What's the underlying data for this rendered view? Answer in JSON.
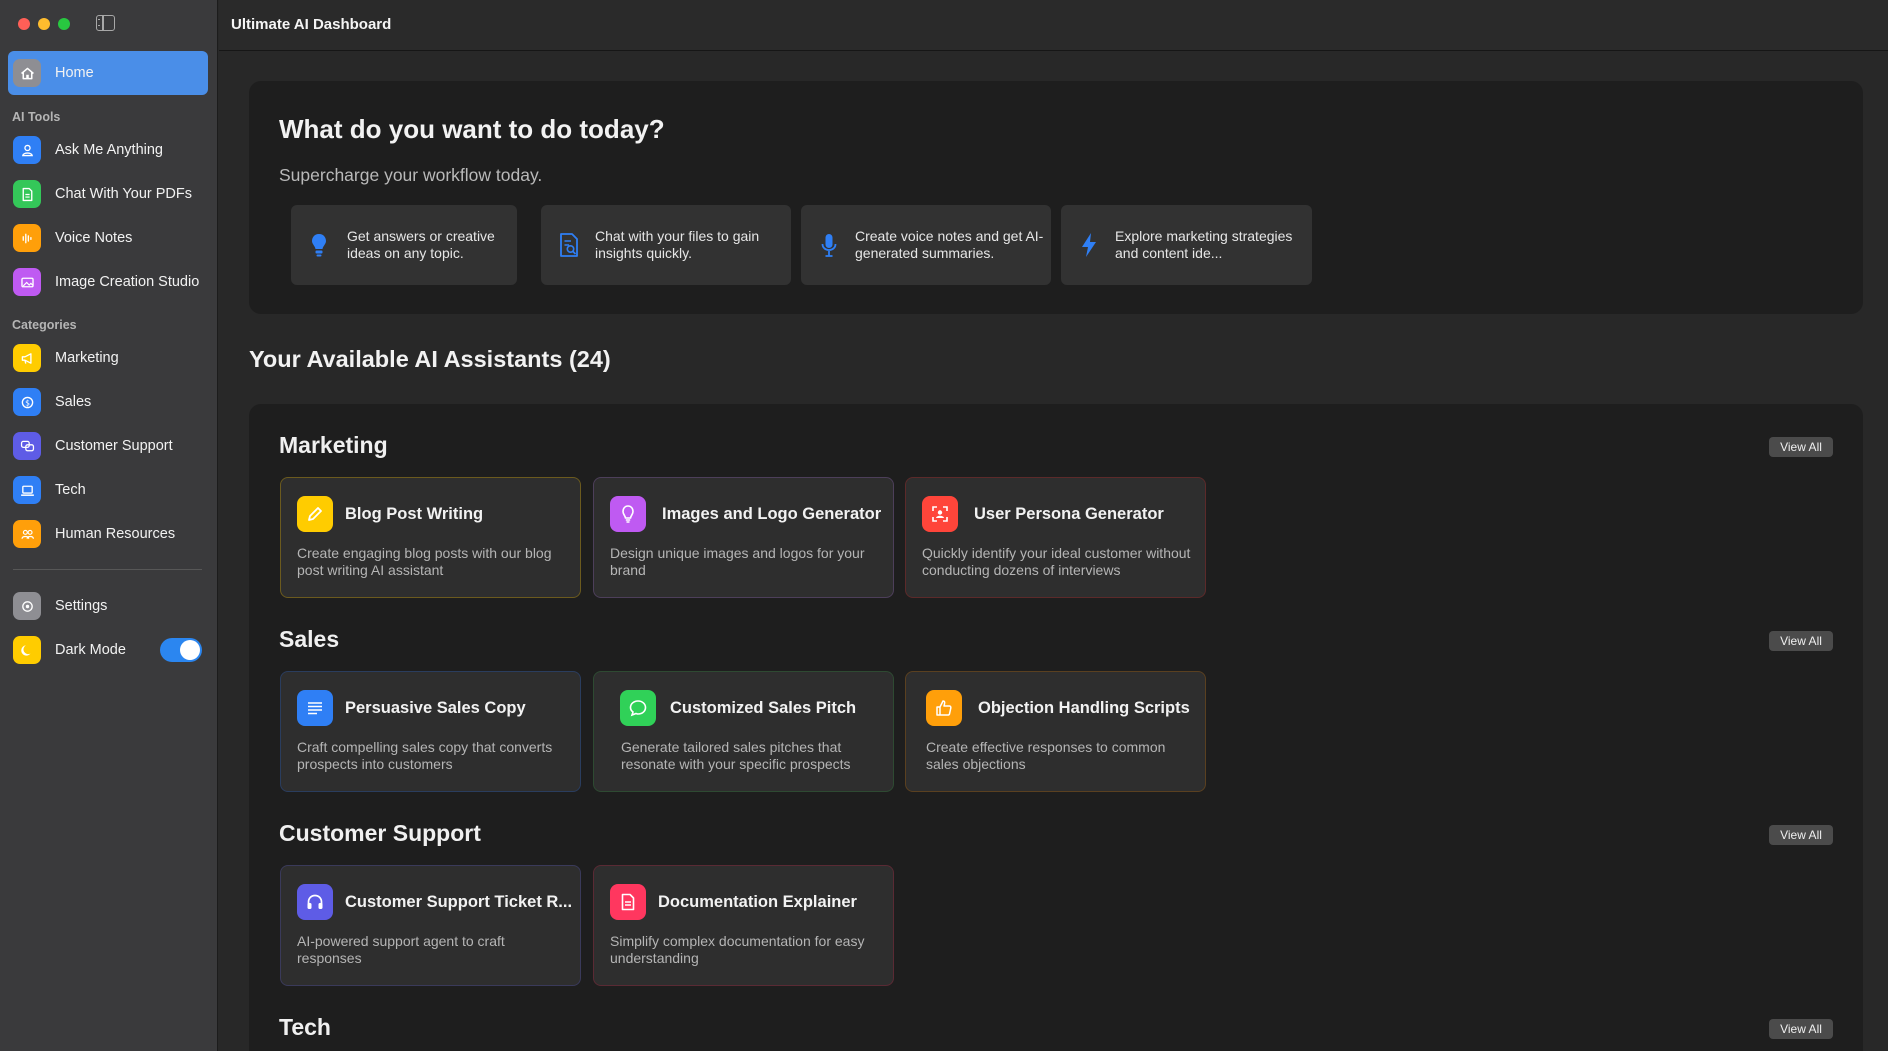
{
  "window": {
    "title": "Ultimate AI Dashboard"
  },
  "sidebar": {
    "home": {
      "label": "Home",
      "icon": "house-icon"
    },
    "ai_tools_heading": "AI Tools",
    "ai_tools": [
      {
        "label": "Ask Me Anything",
        "icon": "person-icon",
        "color": "#2f7ff5"
      },
      {
        "label": "Chat With Your PDFs",
        "icon": "document-icon",
        "color": "#34c759"
      },
      {
        "label": "Voice Notes",
        "icon": "waveform-icon",
        "color": "#ff9f0a"
      },
      {
        "label": "Image Creation Studio",
        "icon": "photo-icon",
        "color": "#bf5af2"
      }
    ],
    "categories_heading": "Categories",
    "categories": [
      {
        "label": "Marketing",
        "icon": "megaphone-icon",
        "color": "#ffcc00"
      },
      {
        "label": "Sales",
        "icon": "dollar-icon",
        "color": "#2f7ff5"
      },
      {
        "label": "Customer Support",
        "icon": "chat-bubbles-icon",
        "color": "#5e5ce6"
      },
      {
        "label": "Tech",
        "icon": "laptop-icon",
        "color": "#2f7ff5"
      },
      {
        "label": "Human Resources",
        "icon": "people-icon",
        "color": "#ff9f0a"
      }
    ],
    "settings": {
      "label": "Settings",
      "icon": "gear-icon"
    },
    "dark_mode": {
      "label": "Dark Mode",
      "icon": "moon-icon",
      "enabled": true
    }
  },
  "hero": {
    "title": "What do you want to do today?",
    "subtitle": "Supercharge your workflow today.",
    "quick_actions": [
      {
        "text": "Get answers or creative ideas on any topic.",
        "icon": "lightbulb-icon"
      },
      {
        "text": "Chat with your files to gain insights quickly.",
        "icon": "document-search-icon"
      },
      {
        "text": "Create voice notes and get AI-generated summaries.",
        "icon": "microphone-icon"
      },
      {
        "text": "Explore marketing strategies and content ide...",
        "icon": "bolt-icon"
      }
    ]
  },
  "assistants": {
    "heading": "Your Available AI Assistants (24)",
    "view_all_label": "View All",
    "sections": [
      {
        "title": "Marketing",
        "cards": [
          {
            "title": "Blog Post Writing",
            "desc": "Create engaging blog posts with our blog post writing AI assistant",
            "icon": "pencil-icon",
            "color": "#ffcc00"
          },
          {
            "title": "Images and Logo Generator",
            "desc": "Design unique images and logos for your brand",
            "icon": "lightbulb-icon",
            "color": "#bf5af2"
          },
          {
            "title": "User Persona Generator",
            "desc": "Quickly identify your ideal customer without conducting dozens of interviews",
            "icon": "person-viewfinder-icon",
            "color": "#ff453a"
          }
        ]
      },
      {
        "title": "Sales",
        "cards": [
          {
            "title": "Persuasive Sales Copy",
            "desc": "Craft compelling sales copy that converts prospects into customers",
            "icon": "text-lines-icon",
            "color": "#2f7ff5"
          },
          {
            "title": "Customized Sales Pitch",
            "desc": "Generate tailored sales pitches that resonate with your specific prospects",
            "icon": "speech-bubble-icon",
            "color": "#30d158"
          },
          {
            "title": "Objection Handling Scripts",
            "desc": "Create effective responses to common sales objections",
            "icon": "thumbs-up-icon",
            "color": "#ff9f0a"
          }
        ]
      },
      {
        "title": "Customer Support",
        "cards": [
          {
            "title": "Customer Support Ticket R...",
            "desc": "AI-powered support agent to craft responses",
            "icon": "headphones-icon",
            "color": "#5e5ce6"
          },
          {
            "title": "Documentation Explainer",
            "desc": "Simplify complex documentation for easy understanding",
            "icon": "document-icon",
            "color": "#ff375f"
          }
        ]
      },
      {
        "title": "Tech",
        "cards": []
      }
    ]
  }
}
